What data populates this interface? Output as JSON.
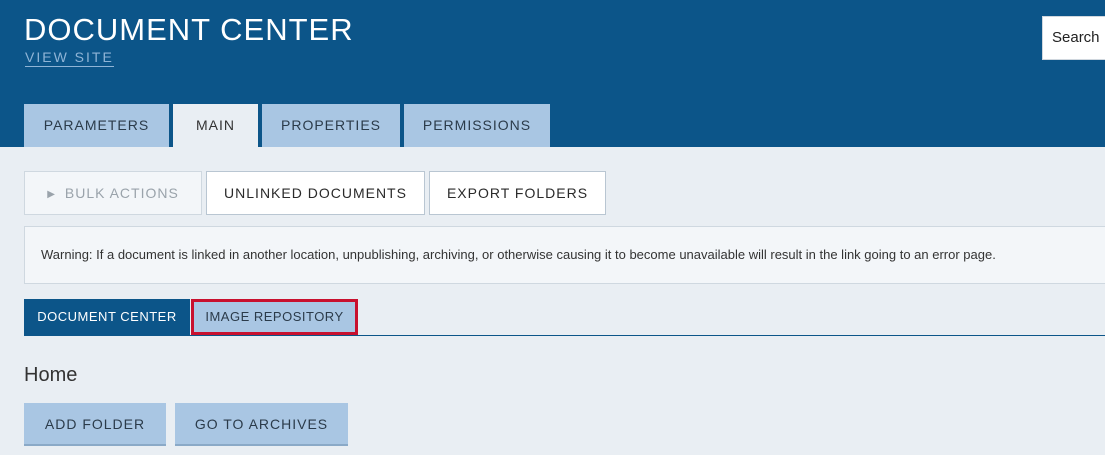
{
  "header": {
    "title": "DOCUMENT CENTER",
    "view_site": "VIEW SITE",
    "search_label": "Search"
  },
  "top_tabs": [
    {
      "label": "PARAMETERS",
      "active": false
    },
    {
      "label": "MAIN",
      "active": true
    },
    {
      "label": "PROPERTIES",
      "active": false
    },
    {
      "label": "PERMISSIONS",
      "active": false
    }
  ],
  "actions": {
    "bulk_actions": "BULK ACTIONS",
    "unlinked_documents": "UNLINKED DOCUMENTS",
    "export_folders": "EXPORT FOLDERS"
  },
  "warning": "Warning: If a document is linked in another location, unpublishing, archiving, or otherwise causing it to become unavailable will result in the link going to an error page.",
  "sub_tabs": [
    {
      "label": "DOCUMENT CENTER",
      "active": true
    },
    {
      "label": "IMAGE REPOSITORY",
      "active": false,
      "highlighted": true
    }
  ],
  "content": {
    "heading": "Home",
    "add_folder": "ADD FOLDER",
    "go_to_archives": "GO TO ARCHIVES"
  },
  "colors": {
    "header_bg": "#0c5589",
    "tab_bg": "#a9c6e3",
    "page_bg": "#e9eef3",
    "highlight": "#c8102e"
  }
}
